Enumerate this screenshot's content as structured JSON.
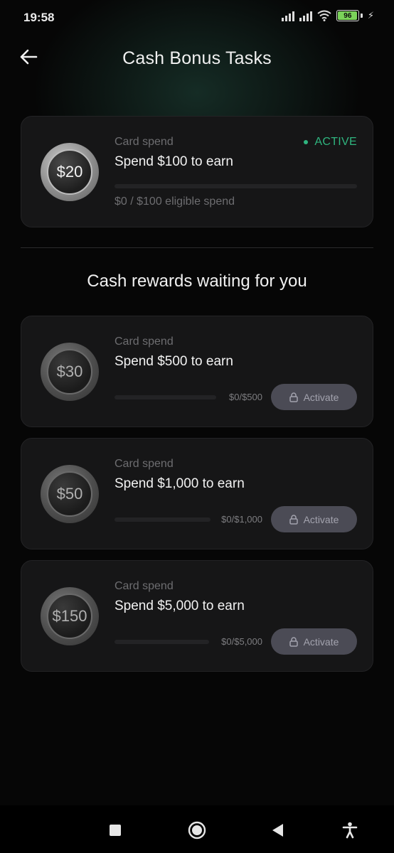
{
  "status_bar": {
    "time": "19:58",
    "battery_level": "96",
    "battery_fraction": 0.96,
    "icons": [
      "signal-icon",
      "signal-icon",
      "wifi-icon",
      "battery-icon",
      "charging-bolt-icon"
    ]
  },
  "header": {
    "back_icon": "arrow-left-icon",
    "title": "Cash Bonus Tasks"
  },
  "active_task": {
    "coin_value": "$20",
    "label": "Card spend",
    "title": "Spend $100 to earn",
    "status": "ACTIVE",
    "progress_fraction": 0,
    "eligible_text": "$0 / $100 eligible spend"
  },
  "section_title": "Cash rewards waiting for you",
  "tasks": [
    {
      "coin_value": "$30",
      "label": "Card spend",
      "title": "Spend $500 to earn",
      "progress_text": "$0/$500",
      "progress_fraction": 0,
      "button_label": "Activate",
      "button_icon": "lock-icon"
    },
    {
      "coin_value": "$50",
      "label": "Card spend",
      "title": "Spend $1,000 to earn",
      "progress_text": "$0/$1,000",
      "progress_fraction": 0,
      "button_label": "Activate",
      "button_icon": "lock-icon"
    },
    {
      "coin_value": "$150",
      "label": "Card spend",
      "title": "Spend $5,000 to earn",
      "progress_text": "$0/$5,000",
      "progress_fraction": 0,
      "button_label": "Activate",
      "button_icon": "lock-icon"
    }
  ],
  "nav": {
    "icons": [
      "recents-square-icon",
      "home-circle-icon",
      "back-triangle-icon",
      "accessibility-icon"
    ]
  },
  "colors": {
    "accent_green": "#2fb57f",
    "background": "#060606",
    "card_background": "#161617",
    "button_background": "#4b4b55"
  }
}
